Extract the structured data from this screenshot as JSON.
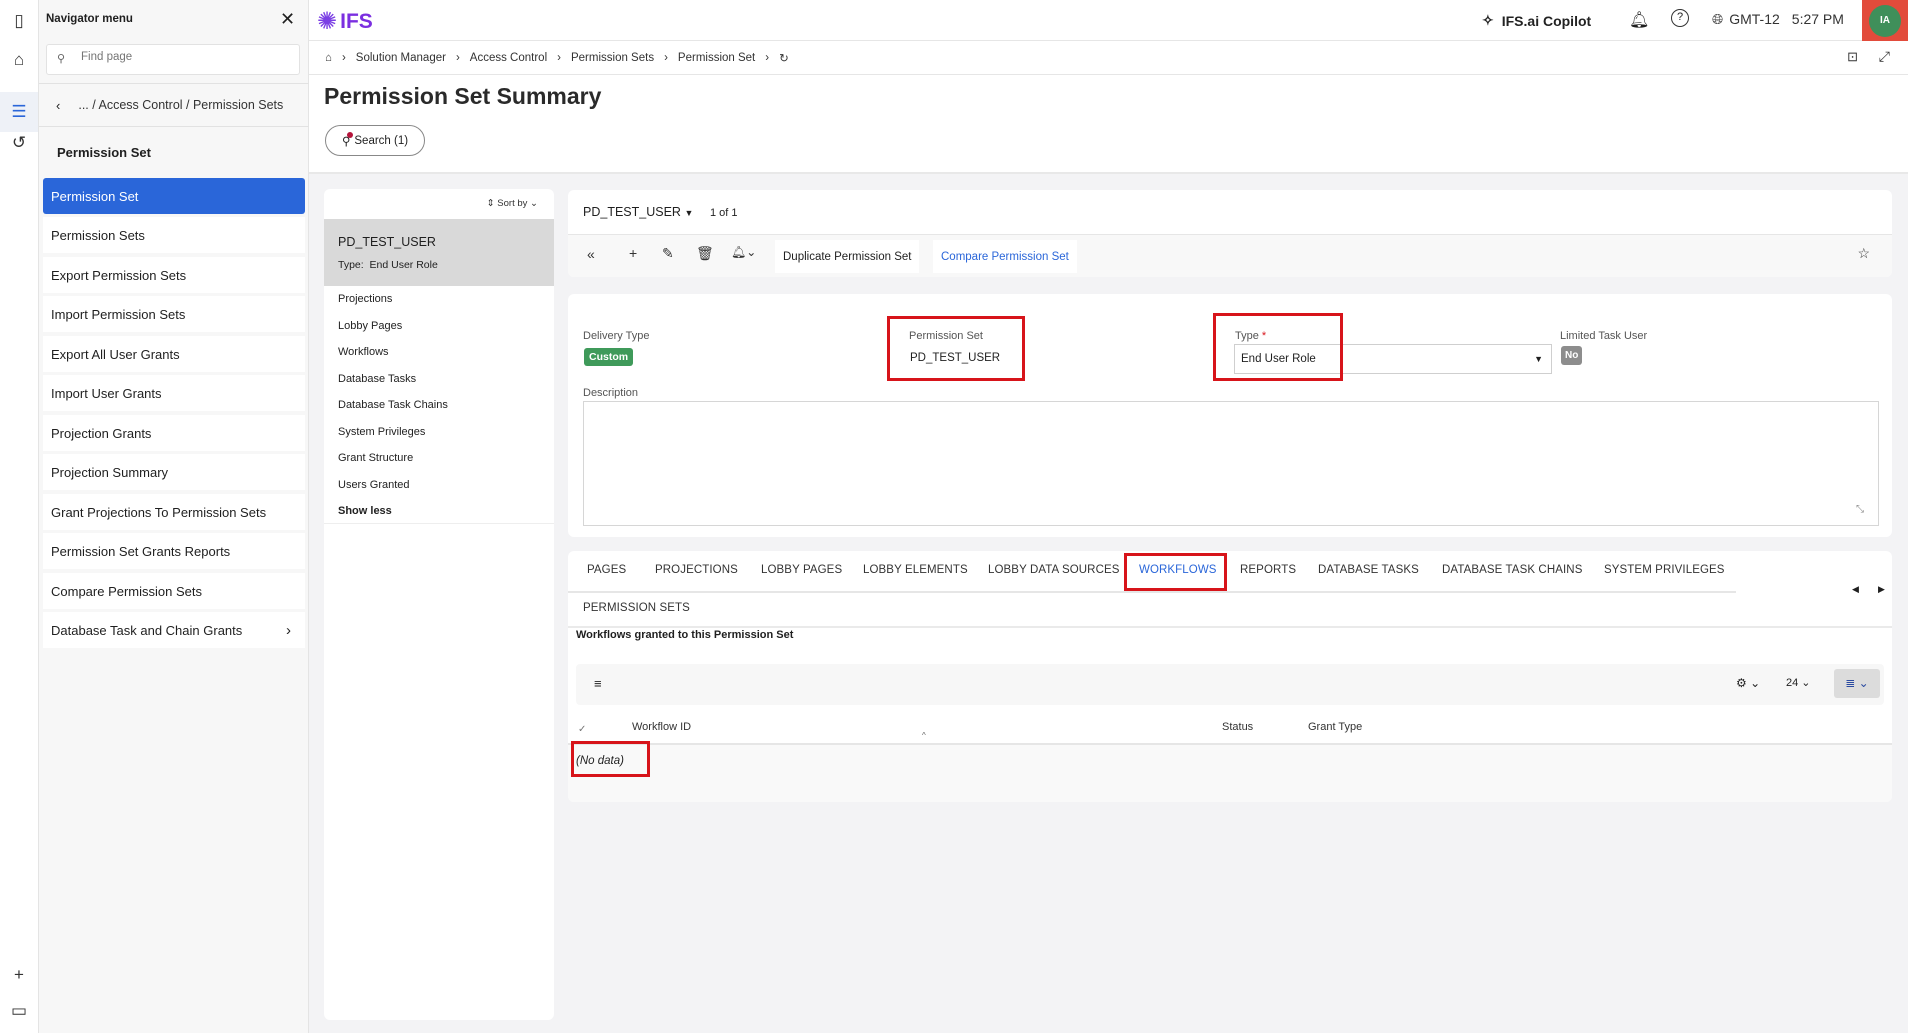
{
  "navigator": {
    "title": "Navigator menu",
    "search_placeholder": "Find page",
    "path": "... / Access Control / Permission Sets",
    "section_title": "Permission Set",
    "items": [
      {
        "label": "Permission Set"
      },
      {
        "label": "Permission Sets"
      },
      {
        "label": "Export Permission Sets"
      },
      {
        "label": "Import Permission Sets"
      },
      {
        "label": "Export All User Grants"
      },
      {
        "label": "Import User Grants"
      },
      {
        "label": "Projection Grants"
      },
      {
        "label": "Projection Summary"
      },
      {
        "label": "Grant Projections To Permission Sets"
      },
      {
        "label": "Permission Set Grants Reports"
      },
      {
        "label": "Compare Permission Sets"
      },
      {
        "label": "Database Task and Chain Grants"
      }
    ]
  },
  "header": {
    "logo": "IFS",
    "copilot": "IFS.ai Copilot",
    "timezone": "GMT-12",
    "time": "5:27 PM",
    "avatar": "IA"
  },
  "breadcrumb": [
    "Solution Manager",
    "Access Control",
    "Permission Sets",
    "Permission Set"
  ],
  "page": {
    "title": "Permission Set Summary",
    "search_label": "Search (1)"
  },
  "list": {
    "sort_label": "Sort by",
    "selected_title": "PD_TEST_USER",
    "selected_type_label": "Type:",
    "selected_type": "End User Role",
    "links": [
      "Projections",
      "Lobby Pages",
      "Workflows",
      "Database Tasks",
      "Database Task Chains",
      "System Privileges",
      "Grant Structure",
      "Users Granted"
    ],
    "show_less": "Show less"
  },
  "record": {
    "selector": "PD_TEST_USER",
    "count": "1 of 1",
    "duplicate": "Duplicate Permission Set",
    "compare": "Compare Permission Set"
  },
  "form": {
    "delivery_type_label": "Delivery Type",
    "delivery_type": "Custom",
    "permission_set_label": "Permission Set",
    "permission_set": "PD_TEST_USER",
    "type_label": "Type",
    "required": "*",
    "type": "End User Role",
    "limited_label": "Limited Task User",
    "limited": "No",
    "description_label": "Description"
  },
  "tabs": [
    "PAGES",
    "PROJECTIONS",
    "LOBBY PAGES",
    "LOBBY ELEMENTS",
    "LOBBY DATA SOURCES",
    "WORKFLOWS",
    "REPORTS",
    "DATABASE TASKS",
    "DATABASE TASK CHAINS",
    "SYSTEM PRIVILEGES"
  ],
  "tab2": "PERMISSION SETS",
  "table": {
    "caption": "Workflows granted to this Permission Set",
    "page_size": "24",
    "columns": [
      "Workflow ID",
      "Status",
      "Grant Type"
    ],
    "empty": "(No data)"
  },
  "colors": {
    "accent": "#2a66d9",
    "highlight": "#d7141a",
    "custom_badge": "#3f9a5a",
    "avatar": "#3f8f5a"
  }
}
